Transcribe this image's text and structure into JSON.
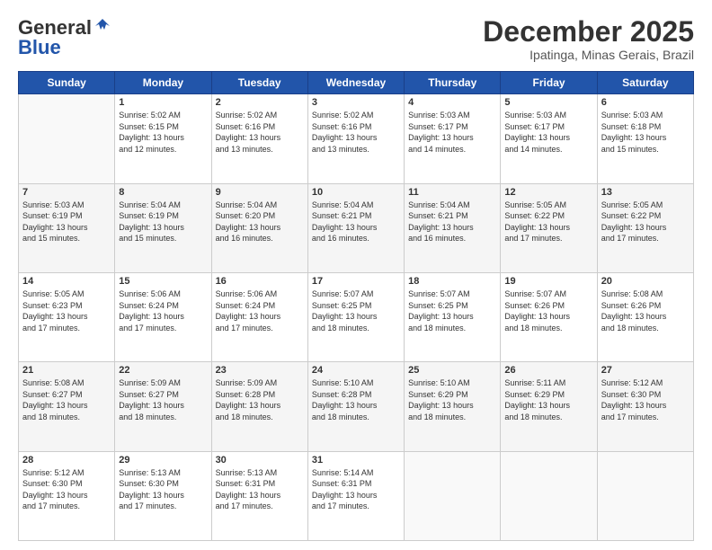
{
  "logo": {
    "line1": "General",
    "line2": "Blue"
  },
  "header": {
    "month": "December 2025",
    "location": "Ipatinga, Minas Gerais, Brazil"
  },
  "weekdays": [
    "Sunday",
    "Monday",
    "Tuesday",
    "Wednesday",
    "Thursday",
    "Friday",
    "Saturday"
  ],
  "weeks": [
    [
      {
        "day": "",
        "info": ""
      },
      {
        "day": "1",
        "info": "Sunrise: 5:02 AM\nSunset: 6:15 PM\nDaylight: 13 hours\nand 12 minutes."
      },
      {
        "day": "2",
        "info": "Sunrise: 5:02 AM\nSunset: 6:16 PM\nDaylight: 13 hours\nand 13 minutes."
      },
      {
        "day": "3",
        "info": "Sunrise: 5:02 AM\nSunset: 6:16 PM\nDaylight: 13 hours\nand 13 minutes."
      },
      {
        "day": "4",
        "info": "Sunrise: 5:03 AM\nSunset: 6:17 PM\nDaylight: 13 hours\nand 14 minutes."
      },
      {
        "day": "5",
        "info": "Sunrise: 5:03 AM\nSunset: 6:17 PM\nDaylight: 13 hours\nand 14 minutes."
      },
      {
        "day": "6",
        "info": "Sunrise: 5:03 AM\nSunset: 6:18 PM\nDaylight: 13 hours\nand 15 minutes."
      }
    ],
    [
      {
        "day": "7",
        "info": "Sunrise: 5:03 AM\nSunset: 6:19 PM\nDaylight: 13 hours\nand 15 minutes."
      },
      {
        "day": "8",
        "info": "Sunrise: 5:04 AM\nSunset: 6:19 PM\nDaylight: 13 hours\nand 15 minutes."
      },
      {
        "day": "9",
        "info": "Sunrise: 5:04 AM\nSunset: 6:20 PM\nDaylight: 13 hours\nand 16 minutes."
      },
      {
        "day": "10",
        "info": "Sunrise: 5:04 AM\nSunset: 6:21 PM\nDaylight: 13 hours\nand 16 minutes."
      },
      {
        "day": "11",
        "info": "Sunrise: 5:04 AM\nSunset: 6:21 PM\nDaylight: 13 hours\nand 16 minutes."
      },
      {
        "day": "12",
        "info": "Sunrise: 5:05 AM\nSunset: 6:22 PM\nDaylight: 13 hours\nand 17 minutes."
      },
      {
        "day": "13",
        "info": "Sunrise: 5:05 AM\nSunset: 6:22 PM\nDaylight: 13 hours\nand 17 minutes."
      }
    ],
    [
      {
        "day": "14",
        "info": "Sunrise: 5:05 AM\nSunset: 6:23 PM\nDaylight: 13 hours\nand 17 minutes."
      },
      {
        "day": "15",
        "info": "Sunrise: 5:06 AM\nSunset: 6:24 PM\nDaylight: 13 hours\nand 17 minutes."
      },
      {
        "day": "16",
        "info": "Sunrise: 5:06 AM\nSunset: 6:24 PM\nDaylight: 13 hours\nand 17 minutes."
      },
      {
        "day": "17",
        "info": "Sunrise: 5:07 AM\nSunset: 6:25 PM\nDaylight: 13 hours\nand 18 minutes."
      },
      {
        "day": "18",
        "info": "Sunrise: 5:07 AM\nSunset: 6:25 PM\nDaylight: 13 hours\nand 18 minutes."
      },
      {
        "day": "19",
        "info": "Sunrise: 5:07 AM\nSunset: 6:26 PM\nDaylight: 13 hours\nand 18 minutes."
      },
      {
        "day": "20",
        "info": "Sunrise: 5:08 AM\nSunset: 6:26 PM\nDaylight: 13 hours\nand 18 minutes."
      }
    ],
    [
      {
        "day": "21",
        "info": "Sunrise: 5:08 AM\nSunset: 6:27 PM\nDaylight: 13 hours\nand 18 minutes."
      },
      {
        "day": "22",
        "info": "Sunrise: 5:09 AM\nSunset: 6:27 PM\nDaylight: 13 hours\nand 18 minutes."
      },
      {
        "day": "23",
        "info": "Sunrise: 5:09 AM\nSunset: 6:28 PM\nDaylight: 13 hours\nand 18 minutes."
      },
      {
        "day": "24",
        "info": "Sunrise: 5:10 AM\nSunset: 6:28 PM\nDaylight: 13 hours\nand 18 minutes."
      },
      {
        "day": "25",
        "info": "Sunrise: 5:10 AM\nSunset: 6:29 PM\nDaylight: 13 hours\nand 18 minutes."
      },
      {
        "day": "26",
        "info": "Sunrise: 5:11 AM\nSunset: 6:29 PM\nDaylight: 13 hours\nand 18 minutes."
      },
      {
        "day": "27",
        "info": "Sunrise: 5:12 AM\nSunset: 6:30 PM\nDaylight: 13 hours\nand 17 minutes."
      }
    ],
    [
      {
        "day": "28",
        "info": "Sunrise: 5:12 AM\nSunset: 6:30 PM\nDaylight: 13 hours\nand 17 minutes."
      },
      {
        "day": "29",
        "info": "Sunrise: 5:13 AM\nSunset: 6:30 PM\nDaylight: 13 hours\nand 17 minutes."
      },
      {
        "day": "30",
        "info": "Sunrise: 5:13 AM\nSunset: 6:31 PM\nDaylight: 13 hours\nand 17 minutes."
      },
      {
        "day": "31",
        "info": "Sunrise: 5:14 AM\nSunset: 6:31 PM\nDaylight: 13 hours\nand 17 minutes."
      },
      {
        "day": "",
        "info": ""
      },
      {
        "day": "",
        "info": ""
      },
      {
        "day": "",
        "info": ""
      }
    ]
  ]
}
